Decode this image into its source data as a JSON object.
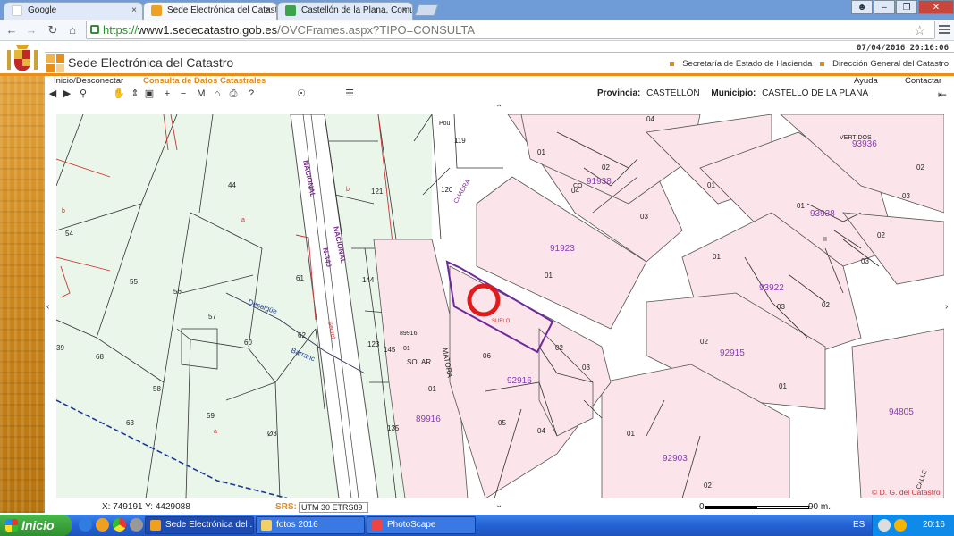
{
  "browser": {
    "tabs": [
      {
        "title": "Google",
        "active": false
      },
      {
        "title": "Sede Electrónica del Catastro",
        "active": true
      },
      {
        "title": "Castellón de la Plana, Comu",
        "active": false
      }
    ],
    "url_scheme": "https://",
    "url_host": "www1.sedecatastro.gob.es",
    "url_path": "/OVCFrames.aspx?TIPO=CONSULTA",
    "close_glyph": "×"
  },
  "header": {
    "datetime": "07/04/2016 20:16:06",
    "site_title": "Sede Electrónica del Catastro",
    "link_1": "Secretaría de Estado de Hacienda",
    "link_2": "Dirección General del Catastro"
  },
  "nav": {
    "login": "Inicio/Desconectar",
    "consulta": "Consulta de Datos Catastrales",
    "ayuda": "Ayuda",
    "contactar": "Contactar"
  },
  "location": {
    "provincia_label": "Provincia:",
    "provincia": "CASTELLÓN",
    "municipio_label": "Municipio:",
    "municipio": "CASTELLO DE LA PLANA"
  },
  "map": {
    "labels": [
      {
        "id": "p119",
        "text": "119"
      },
      {
        "id": "pou",
        "text": "Pou"
      },
      {
        "id": "p121",
        "text": "121"
      },
      {
        "id": "p120",
        "text": "120"
      },
      {
        "id": "p44",
        "text": "44"
      },
      {
        "id": "p54",
        "text": "54"
      },
      {
        "id": "p55",
        "text": "55"
      },
      {
        "id": "p56",
        "text": "56"
      },
      {
        "id": "p57",
        "text": "57"
      },
      {
        "id": "p60",
        "text": "60"
      },
      {
        "id": "p61",
        "text": "61"
      },
      {
        "id": "p62",
        "text": "62"
      },
      {
        "id": "p144",
        "text": "144"
      },
      {
        "id": "p123",
        "text": "123"
      },
      {
        "id": "p145",
        "text": "145"
      },
      {
        "id": "p135",
        "text": "135"
      },
      {
        "id": "p68",
        "text": "68"
      },
      {
        "id": "p58",
        "text": "58"
      },
      {
        "id": "p59",
        "text": "59"
      },
      {
        "id": "p63",
        "text": "63"
      },
      {
        "id": "p63b",
        "text": "Ø3"
      },
      {
        "id": "p39",
        "text": "39"
      },
      {
        "id": "nac1",
        "text": "NACIONAL"
      },
      {
        "id": "nac2",
        "text": "NACIONAL"
      },
      {
        "id": "n340",
        "text": "N-340"
      },
      {
        "id": "desaigue",
        "text": "Desaigüe"
      },
      {
        "id": "barranc",
        "text": "Barranc"
      },
      {
        "id": "cuadra",
        "text": "CUADRA"
      },
      {
        "id": "matora",
        "text": "MATORA"
      },
      {
        "id": "solar",
        "text": "SOLAR"
      },
      {
        "id": "suelo",
        "text": "SUELO"
      },
      {
        "id": "b89916",
        "text": "89916"
      },
      {
        "id": "b89916s",
        "text": "89916"
      },
      {
        "id": "l01a",
        "text": "01"
      },
      {
        "id": "l01b",
        "text": "01"
      },
      {
        "id": "b91923",
        "text": "91923"
      },
      {
        "id": "l01c",
        "text": "01"
      },
      {
        "id": "b91938",
        "text": "91938"
      },
      {
        "id": "co",
        "text": "CO"
      },
      {
        "id": "l02a",
        "text": "02"
      },
      {
        "id": "l03a",
        "text": "03"
      },
      {
        "id": "l04a",
        "text": "04"
      },
      {
        "id": "l01d",
        "text": "01"
      },
      {
        "id": "l04b",
        "text": "04"
      },
      {
        "id": "l01e",
        "text": "01"
      },
      {
        "id": "vertidos",
        "text": "VERTIDOS"
      },
      {
        "id": "b93936",
        "text": "93936"
      },
      {
        "id": "l02b",
        "text": "02"
      },
      {
        "id": "l03b",
        "text": "03"
      },
      {
        "id": "l01f",
        "text": "01"
      },
      {
        "id": "b93938",
        "text": "93938"
      },
      {
        "id": "l02c",
        "text": "02"
      },
      {
        "id": "l03c",
        "text": "03"
      },
      {
        "id": "ii",
        "text": "II"
      },
      {
        "id": "l01g",
        "text": "01"
      },
      {
        "id": "b93922",
        "text": "93922"
      },
      {
        "id": "l03d",
        "text": "03"
      },
      {
        "id": "l02d",
        "text": "02"
      },
      {
        "id": "l02e",
        "text": "02"
      },
      {
        "id": "l03e",
        "text": "03"
      },
      {
        "id": "l06",
        "text": "06"
      },
      {
        "id": "b92916",
        "text": "92916"
      },
      {
        "id": "l05",
        "text": "05"
      },
      {
        "id": "l04c",
        "text": "04"
      },
      {
        "id": "l02f",
        "text": "02"
      },
      {
        "id": "b92915",
        "text": "92915"
      },
      {
        "id": "l01h",
        "text": "01"
      },
      {
        "id": "l01i",
        "text": "01"
      },
      {
        "id": "b92903",
        "text": "92903"
      },
      {
        "id": "l02g",
        "text": "02"
      },
      {
        "id": "b94805",
        "text": "94805"
      },
      {
        "id": "calle",
        "text": "CALLE"
      },
      {
        "id": "pa",
        "text": "a"
      },
      {
        "id": "pb",
        "text": "b"
      },
      {
        "id": "pb2",
        "text": "b"
      },
      {
        "id": "secret",
        "text": "Secret"
      },
      {
        "id": "ba",
        "text": "a"
      }
    ]
  },
  "status": {
    "coords": "X: 749191 Y: 4429088",
    "srs_label": "SRS:",
    "srs_value": "UTM 30 ETRS89",
    "scale_start": "0",
    "scale_end": "90 m.",
    "copyright": "© D. G. del Catastro"
  },
  "taskbar": {
    "start": "Inicio",
    "tasks": [
      {
        "title": "Sede Electrónica del ..."
      },
      {
        "title": "fotos 2016"
      },
      {
        "title": "PhotoScape"
      }
    ],
    "lang": "ES",
    "clock": "20:16"
  },
  "colors": {
    "accent": "#e98e17",
    "parcel_fill": "#fbe4ea",
    "rustic_fill": "#e9f6e9",
    "block_label": "#8a3bbd",
    "highlight_ring": "#e01b1b"
  }
}
